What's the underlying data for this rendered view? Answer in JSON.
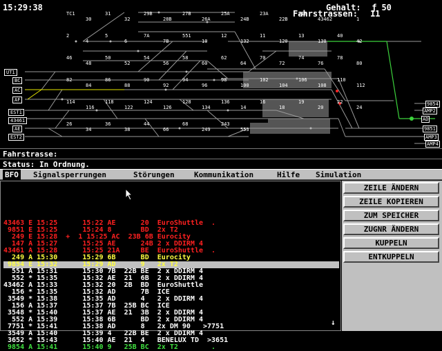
{
  "header": {
    "time": "15:29:38",
    "salary_label": "Gehalt:",
    "salary_value": "ƒ 50",
    "routes_label": "Fahrstrassen:",
    "routes_value": "11"
  },
  "colors": {
    "track": "#9a9a9a",
    "occupied": "#555555",
    "green_track": "#3cd23c",
    "yellow_track": "#e6e600",
    "red": "#ff2020",
    "yellow": "#ffff40",
    "green": "#40e040",
    "white": "#ffffff",
    "panel": "#c0c0c0"
  },
  "map_labels": {
    "left_stubs": [
      "UT1",
      "BC",
      "AC",
      "AF",
      "EST1",
      "43461",
      "AE",
      "EST2"
    ],
    "right_stubs": [
      "9854",
      "AMP2",
      "AD",
      "9851",
      "AMP3",
      "AMP4"
    ],
    "blocks": [
      "TC1",
      "30",
      "31",
      "32",
      "29B",
      "28B",
      "27B",
      "26A",
      "25A",
      "24B",
      "23A",
      "22B",
      "21B",
      "43462",
      "3",
      "1",
      "2",
      "4",
      "5",
      "6",
      "7A",
      "7B",
      "551",
      "10",
      "12",
      "132",
      "11",
      "120",
      "13",
      "130",
      "40",
      "42",
      "46",
      "48",
      "50",
      "52",
      "54",
      "56",
      "58",
      "60",
      "62",
      "64",
      "70",
      "72",
      "74",
      "76",
      "78",
      "80",
      "82",
      "84",
      "86",
      "88",
      "90",
      "92",
      "94",
      "96",
      "98",
      "100",
      "102",
      "104",
      "106",
      "108",
      "110",
      "112",
      "114",
      "116",
      "118",
      "122",
      "124",
      "126",
      "128",
      "134",
      "136",
      "14",
      "16",
      "18",
      "19",
      "20",
      "22",
      "24",
      "26",
      "34",
      "36",
      "38",
      "44",
      "66",
      "68",
      "249",
      "243",
      "553"
    ]
  },
  "status": {
    "route_label": "Fahrstrasse:",
    "route_value": "",
    "status_label": "Status:",
    "status_value": "In Ordnung."
  },
  "menu": {
    "items": [
      "BFO",
      "Signalsperrungen",
      "Störungen",
      "Kommunikation",
      "Hilfe",
      "Simulation"
    ],
    "active": "BFO"
  },
  "buttons": [
    "ZEILE ÄNDERN",
    "ZEILE KOPIEREN",
    "ZUM SPEICHER",
    "ZUGNR ÄNDERN",
    "KUPPELN",
    "ENTKUPPELN"
  ],
  "schedule_rows": [
    {
      "text": "43463 E 15:25      15:22 AE      20  EuroShuttle  .",
      "color": "#ff2020"
    },
    {
      "text": " 9851 E 15:25      15:24 8       BD  2x T2",
      "color": "#ff2020"
    },
    {
      "text": "  249 E 15:28  +  1 15:25 AC  23B 6B Eurocity",
      "color": "#ff2020"
    },
    {
      "text": "  147 A 15:27      15:25 AE      24B 2 x DDIRM 4",
      "color": "#ff2020"
    },
    {
      "text": "43461 A 15:28      15:25 21A     BE  EuroShuttle  .",
      "color": "#ff2020"
    },
    {
      "text": "  249 A 15:30      15:29 6B      BD  Eurocity",
      "color": "#ffff40"
    },
    {
      "text": " 9854 E 15:32      15:29 AD      9   2x T2",
      "color": "#ffff40",
      "highlight": true
    },
    {
      "text": "  551 A 15:31      15:30 7B  22B BE  2 x DDIRM 4",
      "color": "#ffffff"
    },
    {
      "text": "  552 * 15:35      15:32 AE  21  6B  2 x DDIRM 4",
      "color": "#ffffff"
    },
    {
      "text": "43462 A 15:33      15:32 20  2B  BD  EuroShuttle",
      "color": "#ffffff"
    },
    {
      "text": "  156 * 15:35      15:32 AD      7B  ICE",
      "color": "#ffffff"
    },
    {
      "text": " 3549 * 15:38      15:35 AD      4   2 x DDIRM 4",
      "color": "#ffffff"
    },
    {
      "text": "  156 A 15:37      15:37 7B  25B BC  ICE",
      "color": "#ffffff"
    },
    {
      "text": " 3548 * 15:40      15:37 AE  21  3B  2 x DDIRM 4",
      "color": "#ffffff"
    },
    {
      "text": "  552 A 15:39      15:38 6B      BD  2 x DDIRM 4",
      "color": "#ffffff"
    },
    {
      "text": " 7751 * 15:41      15:38 AD      8   2x DM 90   >7751",
      "color": "#ffffff"
    },
    {
      "text": " 3549 A 15:40      15:39 4   22B BE  2 x DDIRM 4",
      "color": "#ffffff"
    },
    {
      "text": " 3652 * 15:43      15:40 AE  21  4   BENELUX TD  >3651",
      "color": "#ffffff"
    },
    {
      "text": " 9854 A 15:41      15:40 9   25B BC  2x T2        .",
      "color": "#40e040"
    }
  ],
  "scroll_down": "↓"
}
